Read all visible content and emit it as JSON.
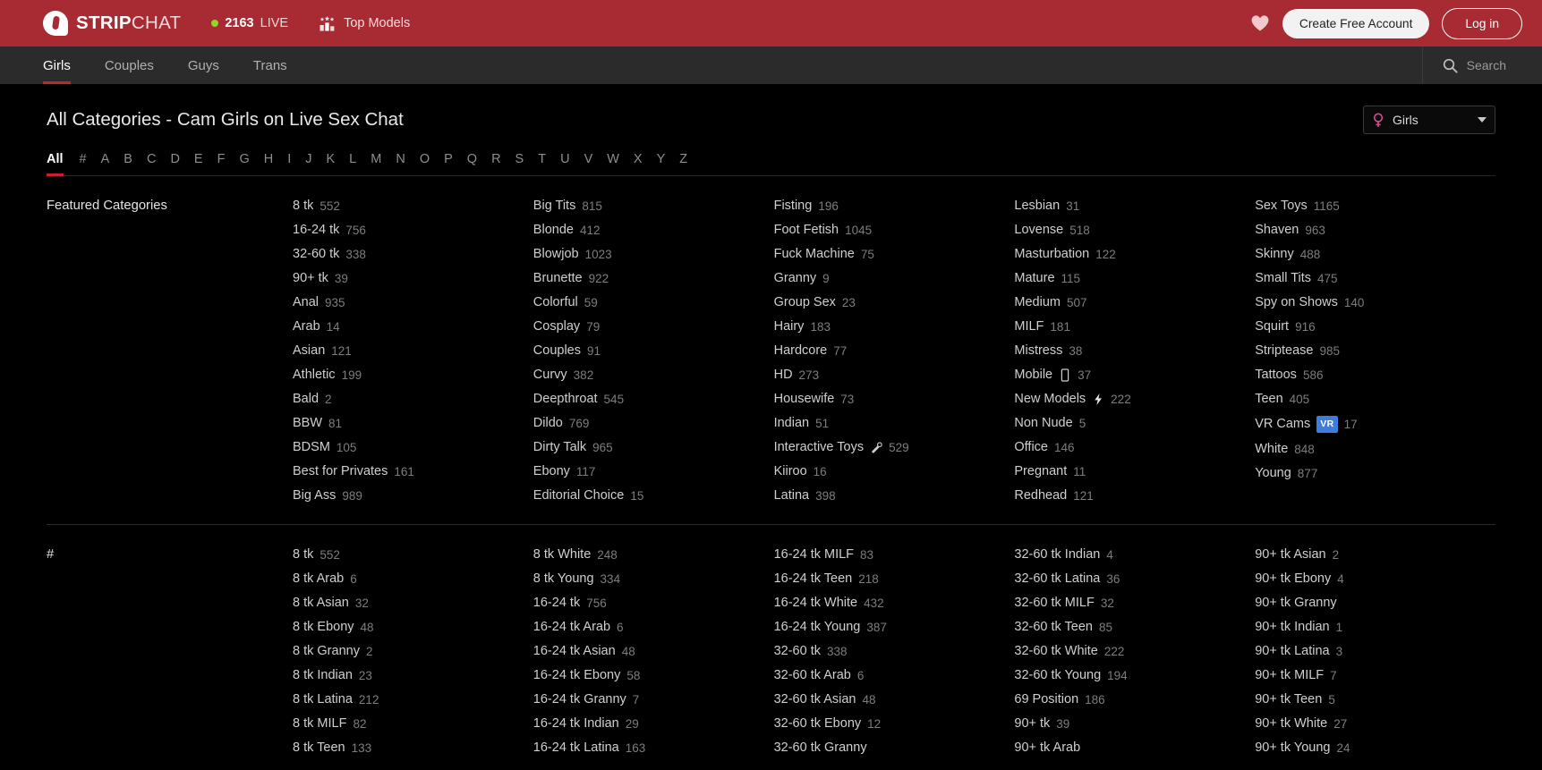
{
  "topbar": {
    "brand_bold": "STRIP",
    "brand_light": "CHAT",
    "live_count": "2163",
    "live_label": "LIVE",
    "top_models_label": "Top Models",
    "create_account_label": "Create Free Account",
    "login_label": "Log in",
    "favorites_icon": "heart-icon",
    "brand_color": "#a82a33"
  },
  "nav": {
    "tabs": [
      {
        "label": "Girls",
        "active": true
      },
      {
        "label": "Couples",
        "active": false
      },
      {
        "label": "Guys",
        "active": false
      },
      {
        "label": "Trans",
        "active": false
      }
    ],
    "search_label": "Search",
    "search_icon": "search-icon",
    "active_underline_color": "#c9202f"
  },
  "page": {
    "title": "All Categories - Cam Girls on Live Sex Chat",
    "gender_filter": {
      "value": "Girls",
      "icon": "venus-icon",
      "caret": "chevron-down-icon"
    }
  },
  "alphabet": {
    "items": [
      "All",
      "#",
      "A",
      "B",
      "C",
      "D",
      "E",
      "F",
      "G",
      "H",
      "I",
      "J",
      "K",
      "L",
      "M",
      "N",
      "O",
      "P",
      "Q",
      "R",
      "S",
      "T",
      "U",
      "V",
      "W",
      "X",
      "Y",
      "Z"
    ],
    "active": "All"
  },
  "sections": [
    {
      "title": "Featured Categories",
      "columns": [
        [
          {
            "name": "8 tk",
            "count": "552"
          },
          {
            "name": "16-24 tk",
            "count": "756"
          },
          {
            "name": "32-60 tk",
            "count": "338"
          },
          {
            "name": "90+ tk",
            "count": "39"
          },
          {
            "name": "Anal",
            "count": "935"
          },
          {
            "name": "Arab",
            "count": "14"
          },
          {
            "name": "Asian",
            "count": "121"
          },
          {
            "name": "Athletic",
            "count": "199"
          },
          {
            "name": "Bald",
            "count": "2"
          },
          {
            "name": "BBW",
            "count": "81"
          },
          {
            "name": "BDSM",
            "count": "105"
          },
          {
            "name": "Best for Privates",
            "count": "161"
          },
          {
            "name": "Big Ass",
            "count": "989"
          }
        ],
        [
          {
            "name": "Big Tits",
            "count": "815"
          },
          {
            "name": "Blonde",
            "count": "412"
          },
          {
            "name": "Blowjob",
            "count": "1023"
          },
          {
            "name": "Brunette",
            "count": "922"
          },
          {
            "name": "Colorful",
            "count": "59"
          },
          {
            "name": "Cosplay",
            "count": "79"
          },
          {
            "name": "Couples",
            "count": "91"
          },
          {
            "name": "Curvy",
            "count": "382"
          },
          {
            "name": "Deepthroat",
            "count": "545"
          },
          {
            "name": "Dildo",
            "count": "769"
          },
          {
            "name": "Dirty Talk",
            "count": "965"
          },
          {
            "name": "Ebony",
            "count": "117"
          },
          {
            "name": "Editorial Choice",
            "count": "15"
          }
        ],
        [
          {
            "name": "Fisting",
            "count": "196"
          },
          {
            "name": "Foot Fetish",
            "count": "1045"
          },
          {
            "name": "Fuck Machine",
            "count": "75"
          },
          {
            "name": "Granny",
            "count": "9"
          },
          {
            "name": "Group Sex",
            "count": "23"
          },
          {
            "name": "Hairy",
            "count": "183"
          },
          {
            "name": "Hardcore",
            "count": "77"
          },
          {
            "name": "HD",
            "count": "273"
          },
          {
            "name": "Housewife",
            "count": "73"
          },
          {
            "name": "Indian",
            "count": "51"
          },
          {
            "name": "Interactive Toys",
            "count": "529",
            "icon": "wand-icon"
          },
          {
            "name": "Kiiroo",
            "count": "16"
          },
          {
            "name": "Latina",
            "count": "398"
          }
        ],
        [
          {
            "name": "Lesbian",
            "count": "31"
          },
          {
            "name": "Lovense",
            "count": "518"
          },
          {
            "name": "Masturbation",
            "count": "122"
          },
          {
            "name": "Mature",
            "count": "115"
          },
          {
            "name": "Medium",
            "count": "507"
          },
          {
            "name": "MILF",
            "count": "181"
          },
          {
            "name": "Mistress",
            "count": "38"
          },
          {
            "name": "Mobile",
            "count": "37",
            "icon": "mobile-icon"
          },
          {
            "name": "New Models",
            "count": "222",
            "icon": "lightning-icon"
          },
          {
            "name": "Non Nude",
            "count": "5"
          },
          {
            "name": "Office",
            "count": "146"
          },
          {
            "name": "Pregnant",
            "count": "11"
          },
          {
            "name": "Redhead",
            "count": "121"
          }
        ],
        [
          {
            "name": "Sex Toys",
            "count": "1165"
          },
          {
            "name": "Shaven",
            "count": "963"
          },
          {
            "name": "Skinny",
            "count": "488"
          },
          {
            "name": "Small Tits",
            "count": "475"
          },
          {
            "name": "Spy on Shows",
            "count": "140"
          },
          {
            "name": "Squirt",
            "count": "916"
          },
          {
            "name": "Striptease",
            "count": "985"
          },
          {
            "name": "Tattoos",
            "count": "586"
          },
          {
            "name": "Teen",
            "count": "405"
          },
          {
            "name": "VR Cams",
            "count": "17",
            "badge": "VR"
          },
          {
            "name": "White",
            "count": "848"
          },
          {
            "name": "Young",
            "count": "877"
          }
        ]
      ]
    },
    {
      "title": "#",
      "columns": [
        [
          {
            "name": "8 tk",
            "count": "552"
          },
          {
            "name": "8 tk Arab",
            "count": "6"
          },
          {
            "name": "8 tk Asian",
            "count": "32"
          },
          {
            "name": "8 tk Ebony",
            "count": "48"
          },
          {
            "name": "8 tk Granny",
            "count": "2"
          },
          {
            "name": "8 tk Indian",
            "count": "23"
          },
          {
            "name": "8 tk Latina",
            "count": "212"
          },
          {
            "name": "8 tk MILF",
            "count": "82"
          },
          {
            "name": "8 tk Teen",
            "count": "133"
          }
        ],
        [
          {
            "name": "8 tk White",
            "count": "248"
          },
          {
            "name": "8 tk Young",
            "count": "334"
          },
          {
            "name": "16-24 tk",
            "count": "756"
          },
          {
            "name": "16-24 tk Arab",
            "count": "6"
          },
          {
            "name": "16-24 tk Asian",
            "count": "48"
          },
          {
            "name": "16-24 tk Ebony",
            "count": "58"
          },
          {
            "name": "16-24 tk Granny",
            "count": "7"
          },
          {
            "name": "16-24 tk Indian",
            "count": "29"
          },
          {
            "name": "16-24 tk Latina",
            "count": "163"
          }
        ],
        [
          {
            "name": "16-24 tk MILF",
            "count": "83"
          },
          {
            "name": "16-24 tk Teen",
            "count": "218"
          },
          {
            "name": "16-24 tk White",
            "count": "432"
          },
          {
            "name": "16-24 tk Young",
            "count": "387"
          },
          {
            "name": "32-60 tk",
            "count": "338"
          },
          {
            "name": "32-60 tk Arab",
            "count": "6"
          },
          {
            "name": "32-60 tk Asian",
            "count": "48"
          },
          {
            "name": "32-60 tk Ebony",
            "count": "12"
          },
          {
            "name": "32-60 tk Granny",
            "count": ""
          }
        ],
        [
          {
            "name": "32-60 tk Indian",
            "count": "4"
          },
          {
            "name": "32-60 tk Latina",
            "count": "36"
          },
          {
            "name": "32-60 tk MILF",
            "count": "32"
          },
          {
            "name": "32-60 tk Teen",
            "count": "85"
          },
          {
            "name": "32-60 tk White",
            "count": "222"
          },
          {
            "name": "32-60 tk Young",
            "count": "194"
          },
          {
            "name": "69 Position",
            "count": "186"
          },
          {
            "name": "90+ tk",
            "count": "39"
          },
          {
            "name": "90+ tk Arab",
            "count": ""
          }
        ],
        [
          {
            "name": "90+ tk Asian",
            "count": "2"
          },
          {
            "name": "90+ tk Ebony",
            "count": "4"
          },
          {
            "name": "90+ tk Granny",
            "count": ""
          },
          {
            "name": "90+ tk Indian",
            "count": "1"
          },
          {
            "name": "90+ tk Latina",
            "count": "3"
          },
          {
            "name": "90+ tk MILF",
            "count": "7"
          },
          {
            "name": "90+ tk Teen",
            "count": "5"
          },
          {
            "name": "90+ tk White",
            "count": "27"
          },
          {
            "name": "90+ tk Young",
            "count": "24"
          }
        ]
      ]
    }
  ]
}
